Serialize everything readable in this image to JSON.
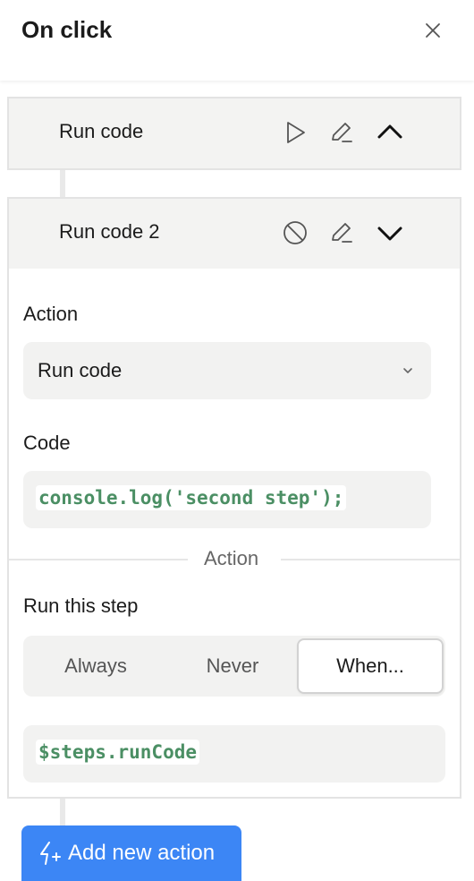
{
  "header": {
    "title": "On click",
    "close_icon": "close-icon"
  },
  "steps": [
    {
      "name": "Run code",
      "icons": [
        "play-icon",
        "edit-icon",
        "chevron-up-icon"
      ]
    },
    {
      "name": "Run code 2",
      "icons": [
        "disabled-icon",
        "edit-icon",
        "chevron-down-icon"
      ],
      "action_label": "Action",
      "action_value": "Run code",
      "code_label": "Code",
      "code_value": "console.log('second step');",
      "divider_label": "Action",
      "run_label": "Run this step",
      "run_options": [
        "Always",
        "Never",
        "When..."
      ],
      "run_selected": "When...",
      "condition_value": "$steps.runCode"
    }
  ],
  "add_action": {
    "label": "Add new action",
    "icon": "lightning-plus-icon"
  },
  "colors": {
    "accent": "#3c86f5",
    "code": "#4b8f64",
    "panel": "#f3f3f2"
  }
}
